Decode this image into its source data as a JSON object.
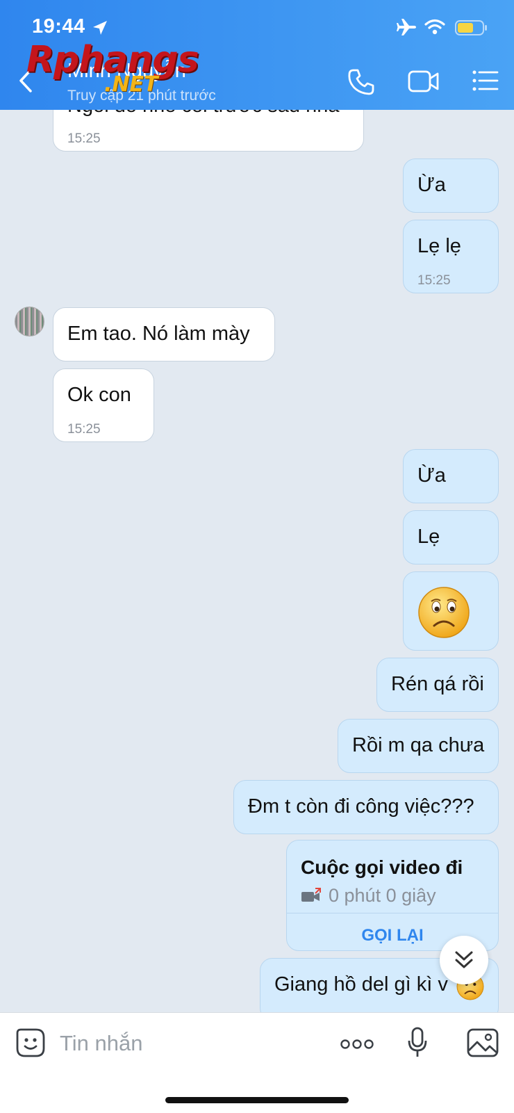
{
  "status_bar": {
    "time": "19:44"
  },
  "header": {
    "contact_name": "Minh Nguyễn",
    "last_seen": "Truy cập 21 phút trước",
    "watermark_main": "Rphangs",
    "watermark_suffix": ".NET"
  },
  "messages": [
    {
      "direction": "in",
      "text": "Ngồi đó nhé coi trước sau nha",
      "time": "15:25"
    },
    {
      "direction": "out",
      "text": "Ừa"
    },
    {
      "direction": "out",
      "text": "Lẹ lẹ",
      "time": "15:25"
    },
    {
      "direction": "in",
      "text": "Em tao. Nó làm mày"
    },
    {
      "direction": "in",
      "text": "Ok con",
      "time": "15:25"
    },
    {
      "direction": "out",
      "text": "Ừa"
    },
    {
      "direction": "out",
      "text": "Lẹ"
    },
    {
      "direction": "out",
      "sticker": "frown-face"
    },
    {
      "direction": "out",
      "text": "Rén qá rồi"
    },
    {
      "direction": "out",
      "text": "Rồi m qa chưa"
    },
    {
      "direction": "out",
      "text": "Đm t còn đi công việc???"
    },
    {
      "direction": "out",
      "call": {
        "title": "Cuộc gọi video đi",
        "duration": "0 phút 0 giây",
        "action": "GỌI LẠI"
      }
    },
    {
      "direction": "out",
      "text": "Giang hồ del gì kì v",
      "sticker": "frown-face"
    }
  ],
  "input_bar": {
    "placeholder": "Tin nhắn"
  },
  "colors": {
    "header_start": "#2f86ee",
    "header_end": "#4aa3f5",
    "outgoing_bubble": "#d4ebfd",
    "incoming_bubble": "#ffffff",
    "chat_background": "#e2e9f1",
    "accent": "#2f86ee"
  },
  "icons": [
    "location-arrow-icon",
    "airplane-icon",
    "wifi-icon",
    "battery-icon",
    "back-chevron-icon",
    "phone-icon",
    "video-call-icon",
    "menu-list-icon",
    "video-camera-icon",
    "chevron-double-down-icon",
    "sticker-icon",
    "more-dots-icon",
    "microphone-icon",
    "image-icon"
  ]
}
